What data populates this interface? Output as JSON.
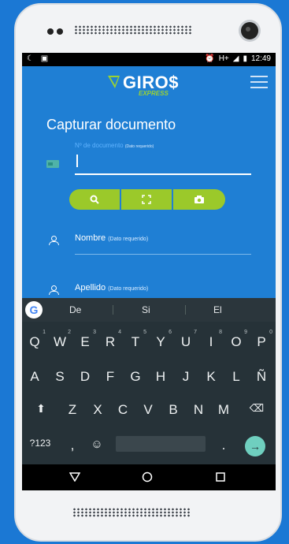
{
  "status": {
    "time": "12:49",
    "network": "H+"
  },
  "header": {
    "logo_text": "GIRO$",
    "logo_sub": "EXPRESS"
  },
  "page": {
    "title": "Capturar documento"
  },
  "form": {
    "doc_label": "Nº de documento",
    "doc_req": "(Dato requerido)",
    "nombre_label": "Nombre",
    "nombre_req": "(Dato requerido)",
    "apellido_label": "Apellido",
    "apellido_req": "(Dato requerido)"
  },
  "buttons": {
    "search_icon": "search-icon",
    "scan_icon": "scan-icon",
    "camera_icon": "camera-icon"
  },
  "keyboard": {
    "suggestions": [
      "De",
      "Si",
      "El"
    ],
    "row1": [
      "Q",
      "W",
      "E",
      "R",
      "T",
      "Y",
      "U",
      "I",
      "O",
      "P"
    ],
    "row1_hints": [
      "1",
      "2",
      "3",
      "4",
      "5",
      "6",
      "7",
      "8",
      "9",
      "0"
    ],
    "row2": [
      "A",
      "S",
      "D",
      "F",
      "G",
      "H",
      "J",
      "K",
      "L",
      "Ñ"
    ],
    "row3": [
      "Z",
      "X",
      "C",
      "V",
      "B",
      "N",
      "M"
    ],
    "symbols_key": "?123",
    "comma": ",",
    "period": "."
  },
  "colors": {
    "app_blue": "#1f7fd4",
    "accent_green": "#9bc92a",
    "keyboard_bg": "#263238"
  }
}
